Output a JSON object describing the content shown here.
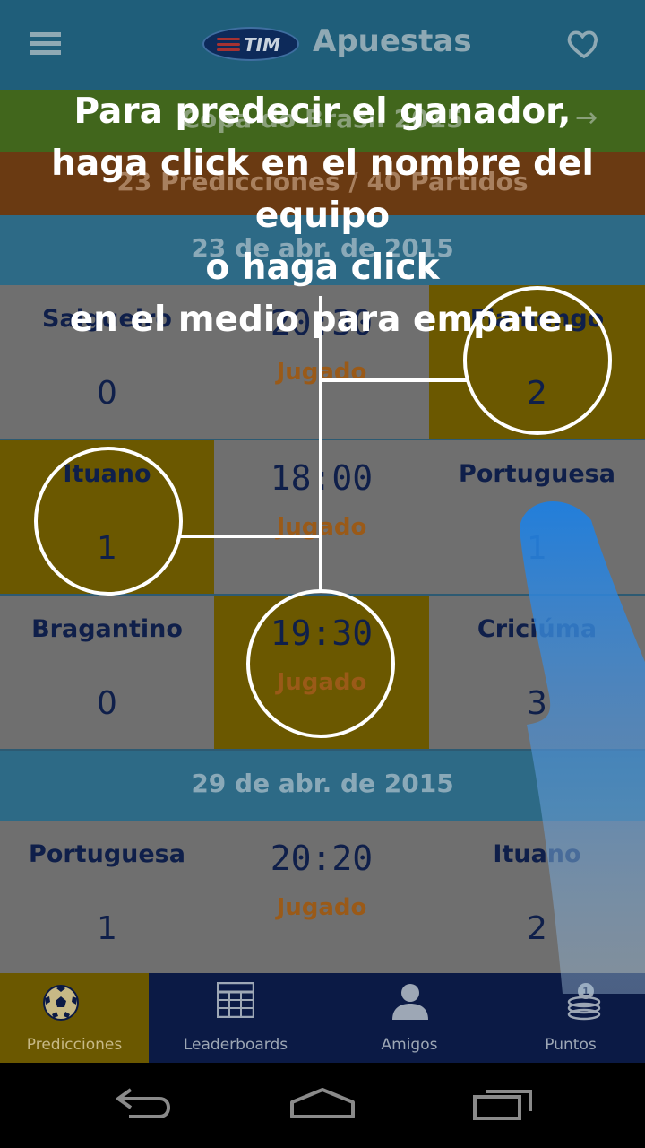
{
  "header": {
    "logo_text": "TIM",
    "title": "Apuestas",
    "menu_icon": "hamburger-menu-icon",
    "favorite_icon": "heart-icon"
  },
  "competition": {
    "name": "Copa do Brasil 2015",
    "arrow": "→"
  },
  "summary": {
    "text": "23 Predicciones / 40 Partidos"
  },
  "days": [
    {
      "date": "23 de abr. de 2015",
      "matches": [
        {
          "home": "Salgueiro",
          "home_score": "0",
          "time": "20:30",
          "status": "Jugado",
          "away": "Flamengo",
          "away_score": "2",
          "selected": "away"
        },
        {
          "home": "Ituano",
          "home_score": "1",
          "time": "18:00",
          "status": "Jugado",
          "away": "Portuguesa",
          "away_score": "1",
          "selected": "home"
        },
        {
          "home": "Bragantino",
          "home_score": "0",
          "time": "19:30",
          "status": "Jugado",
          "away": "Criciúma",
          "away_score": "3",
          "selected": "draw"
        }
      ]
    },
    {
      "date": "29 de abr. de 2015",
      "matches": [
        {
          "home": "Portuguesa",
          "home_score": "1",
          "time": "20:20",
          "status": "Jugado",
          "away": "Ituano",
          "away_score": "2",
          "selected": "none"
        }
      ]
    }
  ],
  "tabs": [
    {
      "label": "Predicciones",
      "icon": "soccer-ball-icon",
      "active": true
    },
    {
      "label": "Leaderboards",
      "icon": "grid-table-icon",
      "active": false
    },
    {
      "label": "Amigos",
      "icon": "person-icon",
      "active": false
    },
    {
      "label": "Puntos",
      "icon": "coins-icon",
      "active": false
    }
  ],
  "tutorial": {
    "lines": [
      "Para predecir el ganador,",
      "haga click en el nombre del equipo",
      "o haga click",
      "en el medio para empate."
    ]
  },
  "system_nav": {
    "back_icon": "back-icon",
    "home_icon": "home-icon",
    "recents_icon": "recents-icon"
  },
  "colors": {
    "header": "#1f5e7a",
    "competition": "#41661c",
    "summary": "#6a3a12",
    "selected": "#6b5800",
    "tabbar": "#0b1a45"
  }
}
